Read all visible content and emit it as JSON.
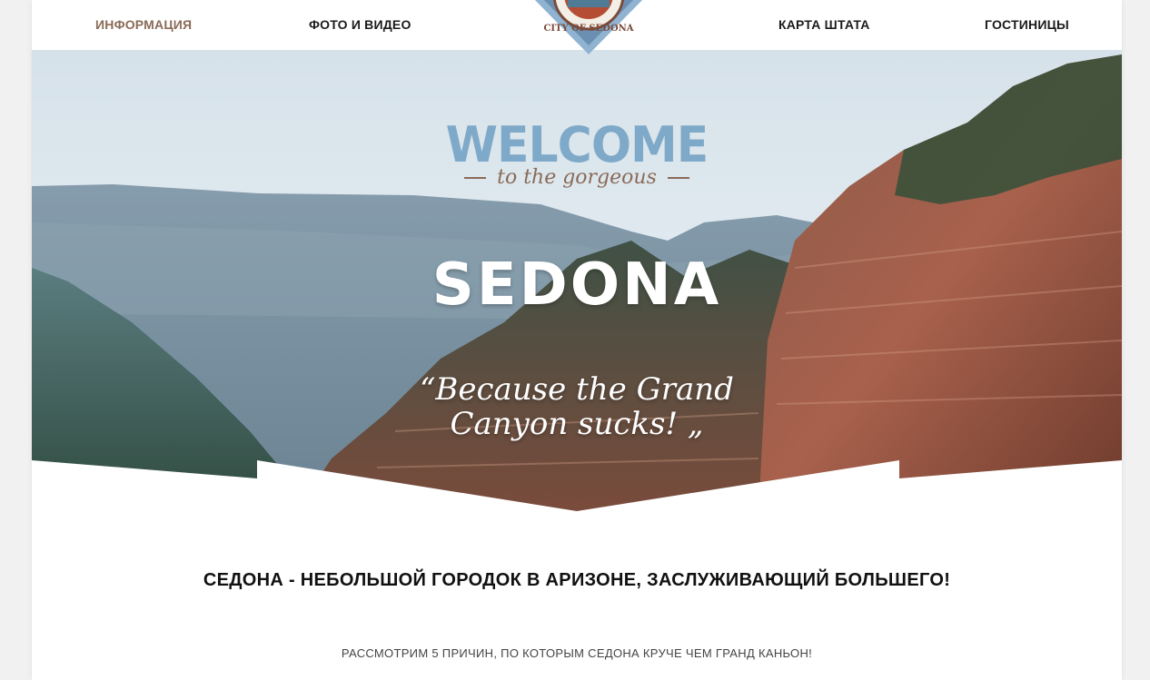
{
  "nav": {
    "items": [
      {
        "label": "ИНФОРМАЦИЯ",
        "active": true
      },
      {
        "label": "ФОТО И ВИДЕО",
        "active": false
      },
      {
        "label": "КАРТА ШТАТА",
        "active": false
      },
      {
        "label": "ГОСТИНИЦЫ",
        "active": false
      }
    ]
  },
  "logo": {
    "text": "CITY OF SEDONA"
  },
  "hero": {
    "welcome": "WELCOME",
    "tagline": "to the gorgeous",
    "title": "SEDONA",
    "quote_line1": "“Because the Grand",
    "quote_line2": "Canyon sucks! „"
  },
  "content": {
    "headline": "СЕДОНА - НЕБОЛЬШОЙ ГОРОДОК В АРИЗОНЕ, ЗАСЛУЖИВАЮЩИЙ БОЛЬШЕГО!",
    "subline": "РАССМОТРИМ 5 ПРИЧИН, ПО КОТОРЫМ СЕДОНА КРУЧЕ ЧЕМ ГРАНД КАНЬОН!"
  },
  "colors": {
    "accent_brown": "#8a6b58",
    "accent_blue": "#7fa9c9",
    "text_dark": "#111111"
  }
}
